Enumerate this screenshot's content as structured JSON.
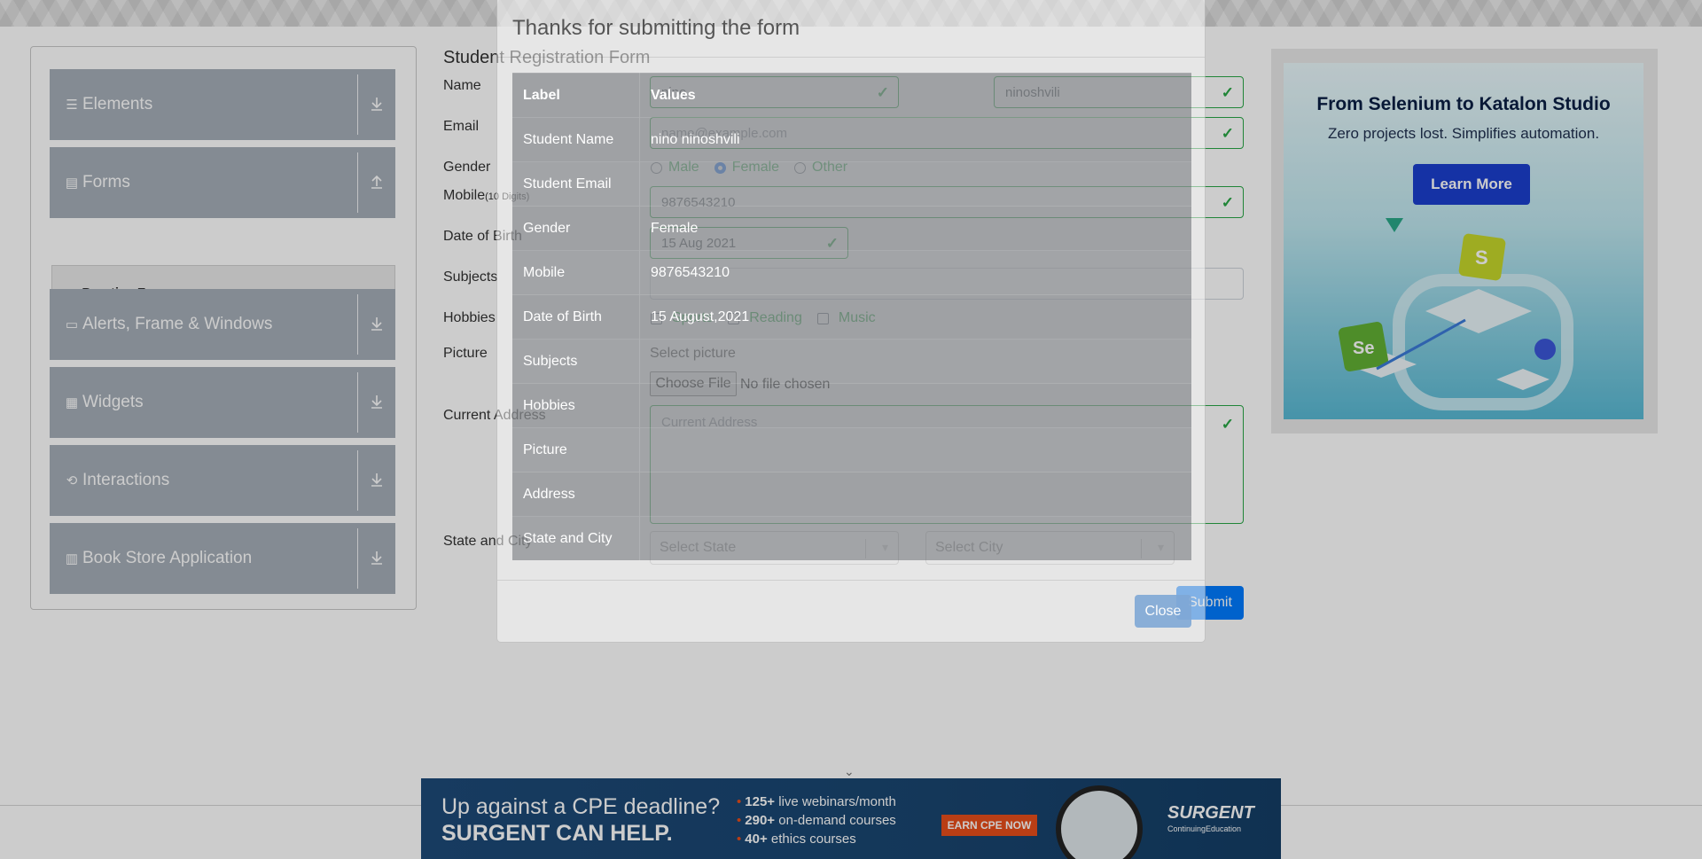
{
  "sidebar": {
    "groups": [
      {
        "label": "Elements",
        "icon": "hamburger-icon"
      },
      {
        "label": "Forms",
        "icon": "document-icon"
      },
      {
        "label": "Alerts, Frame & Windows",
        "icon": "window-icon"
      },
      {
        "label": "Widgets",
        "icon": "widgets-icon"
      },
      {
        "label": "Interactions",
        "icon": "interactions-icon"
      },
      {
        "label": "Book Store Application",
        "icon": "books-icon"
      }
    ],
    "active_item": "Practice Form"
  },
  "form": {
    "title": "Student Registration Form",
    "labels": {
      "name": "Name",
      "email": "Email",
      "gender": "Gender",
      "mobile": "Mobile",
      "mobile_hint": "(10 Digits)",
      "dob": "Date of Birth",
      "subjects": "Subjects",
      "hobbies": "Hobbies",
      "picture": "Picture",
      "address": "Current Address",
      "state_city": "State and City"
    },
    "first_name": "nino",
    "last_name": "ninoshvili",
    "email_placeholder": "name@example.com",
    "gender_options": [
      "Male",
      "Female",
      "Other"
    ],
    "gender_selected": "Female",
    "mobile": "9876543210",
    "dob": "15 Aug 2021",
    "hobbies": [
      "Sports",
      "Reading",
      "Music"
    ],
    "picture_label": "Select picture",
    "choose_file": "Choose File",
    "no_file": "No file chosen",
    "address_placeholder": "Current Address",
    "state_placeholder": "Select State",
    "city_placeholder": "Select City",
    "submit": "Submit"
  },
  "modal": {
    "title": "Thanks for submitting the form",
    "headers": {
      "label": "Label",
      "values": "Values"
    },
    "rows": [
      {
        "label": "Student Name",
        "value": "nino ninoshvili"
      },
      {
        "label": "Student Email",
        "value": ""
      },
      {
        "label": "Gender",
        "value": "Female"
      },
      {
        "label": "Mobile",
        "value": "9876543210"
      },
      {
        "label": "Date of Birth",
        "value": "15 August,2021"
      },
      {
        "label": "Subjects",
        "value": ""
      },
      {
        "label": "Hobbies",
        "value": ""
      },
      {
        "label": "Picture",
        "value": ""
      },
      {
        "label": "Address",
        "value": ""
      },
      {
        "label": "State and City",
        "value": ""
      }
    ],
    "close": "Close"
  },
  "ad_right": {
    "title": "From Selenium to Katalon Studio",
    "subtitle": "Zero projects lost. Simplifies automation.",
    "button": "Learn More"
  },
  "ad_bottom": {
    "line1": "Up against a CPE deadline?",
    "line2": "SURGENT CAN HELP.",
    "bullets": [
      {
        "num": "125+",
        "text": " live webinars/month"
      },
      {
        "num": "290+",
        "text": " on-demand courses"
      },
      {
        "num": "40+",
        "text": " ethics courses"
      }
    ],
    "cta": "EARN CPE NOW",
    "brand": "SURGENT",
    "brand_sub": "ContinuingEducation"
  },
  "colors": {
    "success": "#28a745",
    "primary": "#007bff",
    "sidebar": "#a5aeb8"
  }
}
